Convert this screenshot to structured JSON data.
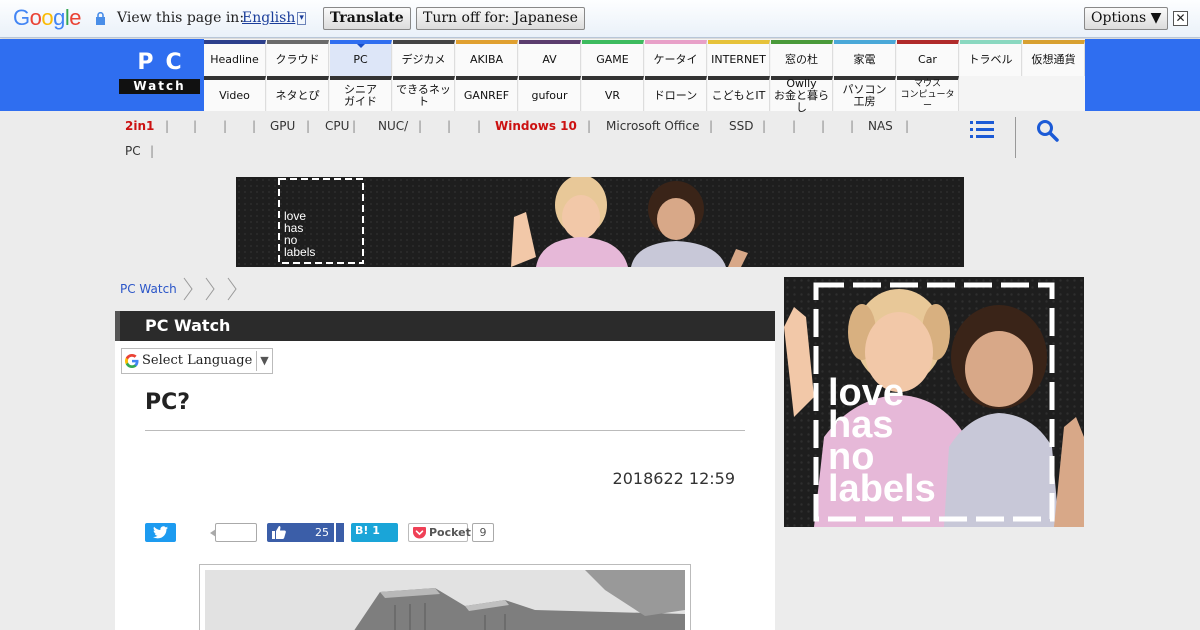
{
  "translate_bar": {
    "logo_text": "Google",
    "view_text": "View this page in:",
    "language": "English",
    "language_caret": "▾",
    "translate_button": "Translate",
    "turn_off_button": "Turn off for: Japanese",
    "options_button": "Options ▼",
    "close_symbol": "✕"
  },
  "site": {
    "logo_top": "PC",
    "logo_bottom": "Watch",
    "nav_row1": [
      {
        "label": "Headline",
        "color": "#2c3f8c"
      },
      {
        "label": "クラウド",
        "color": "#6a6a6a"
      },
      {
        "label": "PC",
        "color": "#2f6ef0"
      },
      {
        "label": "デジカメ",
        "color": "#444444"
      },
      {
        "label": "AKIBA",
        "color": "#e0a030"
      },
      {
        "label": "AV",
        "color": "#5b3d6e"
      },
      {
        "label": "GAME",
        "color": "#3dbb5e"
      },
      {
        "label": "ケータイ",
        "color": "#e8a0c8"
      },
      {
        "label": "INTERNET",
        "color": "#e6c23a"
      },
      {
        "label": "窓の杜",
        "color": "#4a9a3a"
      },
      {
        "label": "家電",
        "color": "#4aa8d8"
      },
      {
        "label": "Car",
        "color": "#b02a2a"
      },
      {
        "label": "トラベル",
        "color": "#8ad8c0"
      },
      {
        "label": "仮想通貨",
        "color": "#d8a030"
      }
    ],
    "nav_row2": [
      {
        "label": "Video",
        "color": "#333333"
      },
      {
        "label": "ネタとぴ",
        "color": "#333333"
      },
      {
        "label": "シニア\nガイド",
        "color": "#333333"
      },
      {
        "label": "できるネット",
        "color": "#333333"
      },
      {
        "label": "GANREF",
        "color": "#333333"
      },
      {
        "label": "gufour",
        "color": "#333333"
      },
      {
        "label": "VR",
        "color": "#333333"
      },
      {
        "label": "ドローン",
        "color": "#333333"
      },
      {
        "label": "こどもとIT",
        "color": "#333333"
      },
      {
        "label": "Owlly\nお金と暮らし",
        "color": "#333333"
      },
      {
        "label": "パソコン\n工房",
        "color": "#333333"
      },
      {
        "label": "マウス\nコンピューター",
        "color": "#333333"
      }
    ],
    "subnav": [
      {
        "label": "2in1",
        "red": true
      },
      {
        "label": "GPU",
        "red": false
      },
      {
        "label": "CPU",
        "red": false
      },
      {
        "label": "NUC/",
        "red": false
      },
      {
        "label": "Windows 10",
        "red": true
      },
      {
        "label": "Microsoft Office",
        "red": false
      },
      {
        "label": "SSD",
        "red": false
      },
      {
        "label": "NAS",
        "red": false
      },
      {
        "label": "PC",
        "red": false
      }
    ]
  },
  "ads": {
    "banner_text": "love\nhas\nno\nlabels",
    "side_text": "love\nhas\nno\nlabels"
  },
  "breadcrumb": {
    "home": "PC Watch"
  },
  "article": {
    "section": "PC Watch",
    "select_language": "Select Language",
    "select_caret": "▼",
    "title": "PC?",
    "date": "2018622 12:59",
    "share": {
      "facebook_count": "25",
      "hatena_label": "B! 1",
      "pocket_label": "Pocket",
      "pocket_count": "9"
    }
  },
  "colors": {
    "site_blue": "#2f6ef0",
    "accent_red": "#cc1111",
    "twitter": "#1d9bf0",
    "facebook": "#3b5ea8",
    "hatena": "#1aa5d8"
  }
}
